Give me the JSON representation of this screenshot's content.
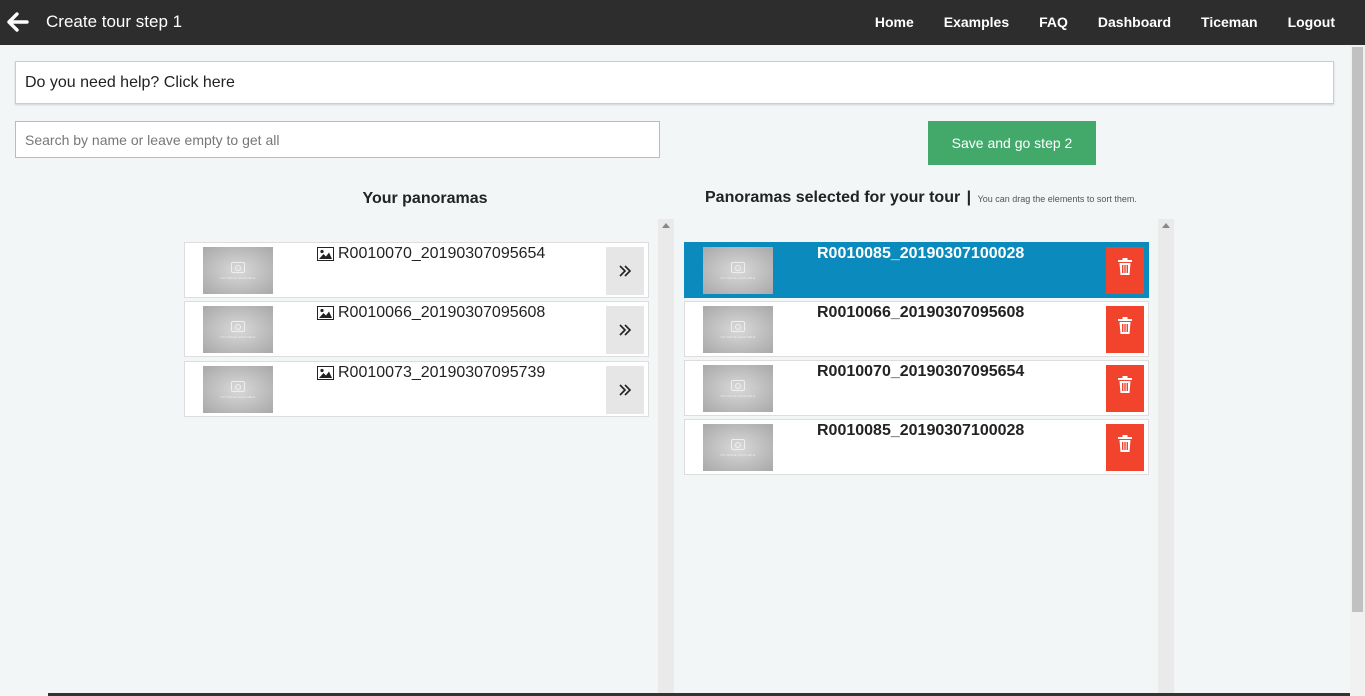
{
  "header": {
    "title": "Create tour step 1",
    "nav": [
      "Home",
      "Examples",
      "FAQ",
      "Dashboard",
      "Ticeman",
      "Logout"
    ]
  },
  "help": {
    "text": "Do you need help? Click here"
  },
  "search": {
    "placeholder": "Search by name or leave empty to get all",
    "value": ""
  },
  "save_button": {
    "label": "Save and go step 2"
  },
  "left_panel": {
    "heading": "Your panoramas",
    "items": [
      {
        "name": "R0010070_20190307095654"
      },
      {
        "name": "R0010066_20190307095608"
      },
      {
        "name": "R0010073_20190307095739"
      }
    ]
  },
  "right_panel": {
    "heading": "Panoramas selected for your tour",
    "separator": "|",
    "hint": "You can drag the elements to sort them.",
    "items": [
      {
        "name": "R0010085_20190307100028",
        "active": true
      },
      {
        "name": "R0010066_20190307095608",
        "active": false
      },
      {
        "name": "R0010070_20190307095654",
        "active": false
      },
      {
        "name": "R0010085_20190307100028",
        "active": false
      }
    ]
  },
  "thumbnail_caption": "NO IMAGE AVAILABLE",
  "colors": {
    "topbar": "#2d2d2d",
    "save": "#43a96b",
    "active": "#0b8bbd",
    "delete": "#f2432d"
  }
}
